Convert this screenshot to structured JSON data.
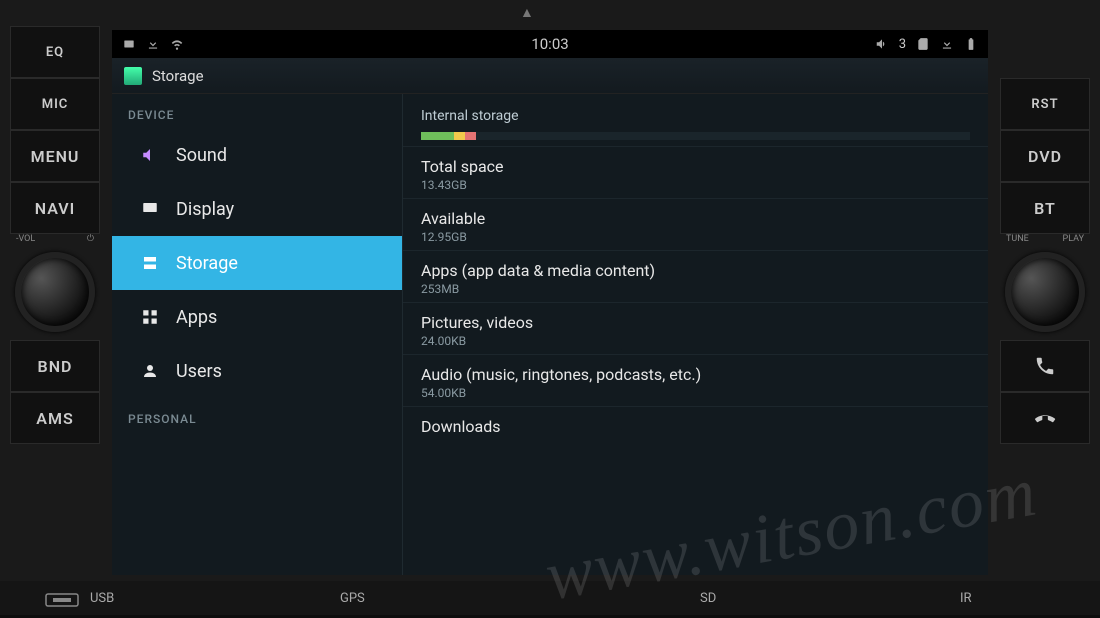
{
  "hw": {
    "eq": "EQ",
    "mic": "MIC",
    "menu": "MENU",
    "navi": "NAVI",
    "bnd": "BND",
    "ams": "AMS",
    "rst": "RST",
    "dvd": "DVD",
    "bt": "BT",
    "vol_minus": "-VOL",
    "vol_power": "⏻",
    "tune": "TUNE",
    "play": "PLAY"
  },
  "bottom": {
    "usb": "USB",
    "gps": "GPS",
    "sd": "SD",
    "ir": "IR"
  },
  "statusbar": {
    "time": "10:03",
    "volume_level": "3"
  },
  "titlebar": {
    "title": "Storage"
  },
  "sidebar": {
    "section_device": "DEVICE",
    "section_personal": "PERSONAL",
    "items": [
      {
        "label": "Sound"
      },
      {
        "label": "Display"
      },
      {
        "label": "Storage"
      },
      {
        "label": "Apps"
      },
      {
        "label": "Users"
      }
    ]
  },
  "storage": {
    "header": "Internal storage",
    "rows": [
      {
        "label": "Total space",
        "value": "13.43GB"
      },
      {
        "label": "Available",
        "value": "12.95GB"
      },
      {
        "label": "Apps (app data & media content)",
        "value": "253MB"
      },
      {
        "label": "Pictures, videos",
        "value": "24.00KB"
      },
      {
        "label": "Audio (music, ringtones, podcasts, etc.)",
        "value": "54.00KB"
      },
      {
        "label": "Downloads",
        "value": ""
      }
    ]
  },
  "watermark": "www.witson.com"
}
